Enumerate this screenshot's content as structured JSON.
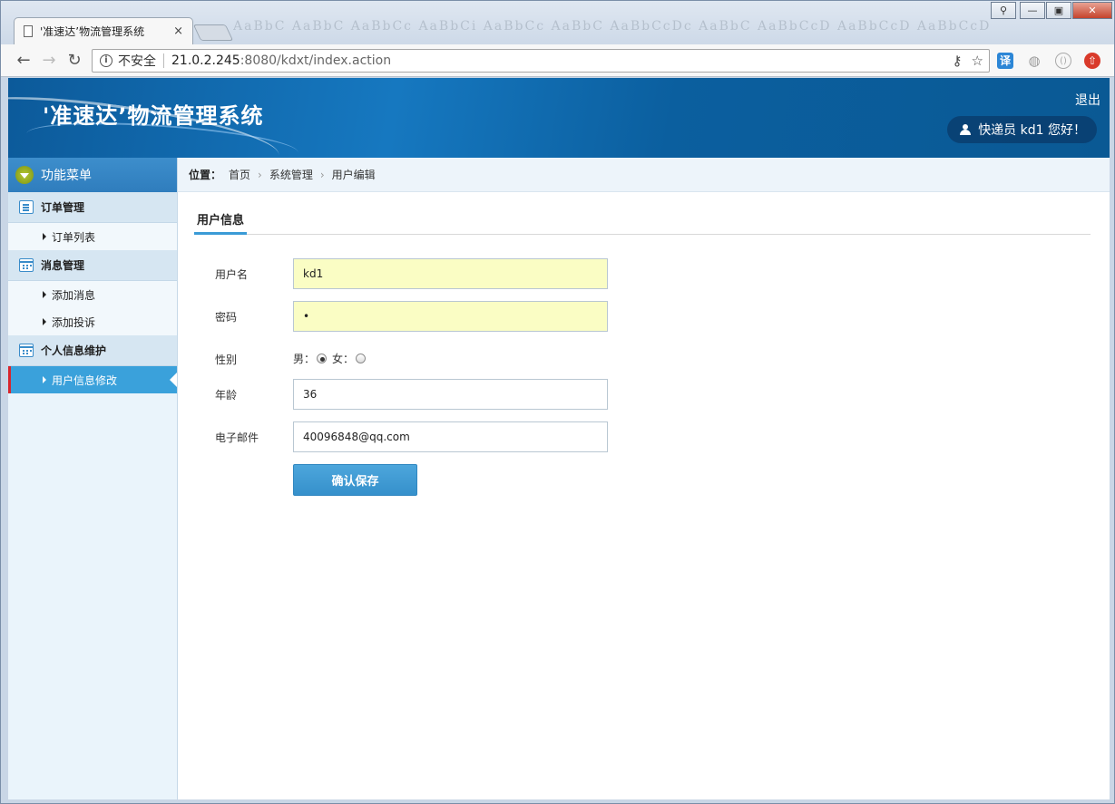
{
  "browser": {
    "tab_title": "'准速达’物流管理系统",
    "tab_close": "×",
    "ghost_styles": "AaBbC  AaBbC  AaBbCc  AaBbCi  AaBbCc  AaBbC  AaBbCcDc  AaBbC  AaBbCcD  AaBbCcD  AaBbCcD",
    "url_security": "不安全",
    "url_host": "21.0.2.245",
    "url_rest": ":8080/kdxt/index.action",
    "ext_translate": "译"
  },
  "header": {
    "site_title": "'准速达’物流管理系统",
    "logout": "退出",
    "greeting": "快递员  kd1 您好！"
  },
  "sidebar": {
    "menu_title": "功能菜单",
    "groups": [
      {
        "label": "订单管理",
        "items": [
          {
            "label": "订单列表"
          }
        ]
      },
      {
        "label": "消息管理",
        "items": [
          {
            "label": "添加消息"
          },
          {
            "label": "添加投诉"
          }
        ]
      },
      {
        "label": "个人信息维护",
        "items": [
          {
            "label": "用户信息修改"
          }
        ]
      }
    ]
  },
  "breadcrumb": {
    "label": "位置：",
    "items": [
      "首页",
      "系统管理",
      "用户编辑"
    ]
  },
  "content": {
    "tab": "用户信息",
    "form": {
      "username_label": "用户名",
      "username_value": "kd1",
      "password_label": "密码",
      "password_value": "•",
      "gender_label": "性别",
      "gender_male": "男：",
      "gender_female": "女：",
      "gender_selected": "男",
      "age_label": "年龄",
      "age_value": "36",
      "email_label": "电子邮件",
      "email_value": "40096848@qq.com",
      "save_label": "确认保存"
    }
  },
  "colors": {
    "banner": "#1678c0",
    "accent": "#3aa1db",
    "active_marker": "#d8252c",
    "input_highlight": "#fafdc4"
  }
}
